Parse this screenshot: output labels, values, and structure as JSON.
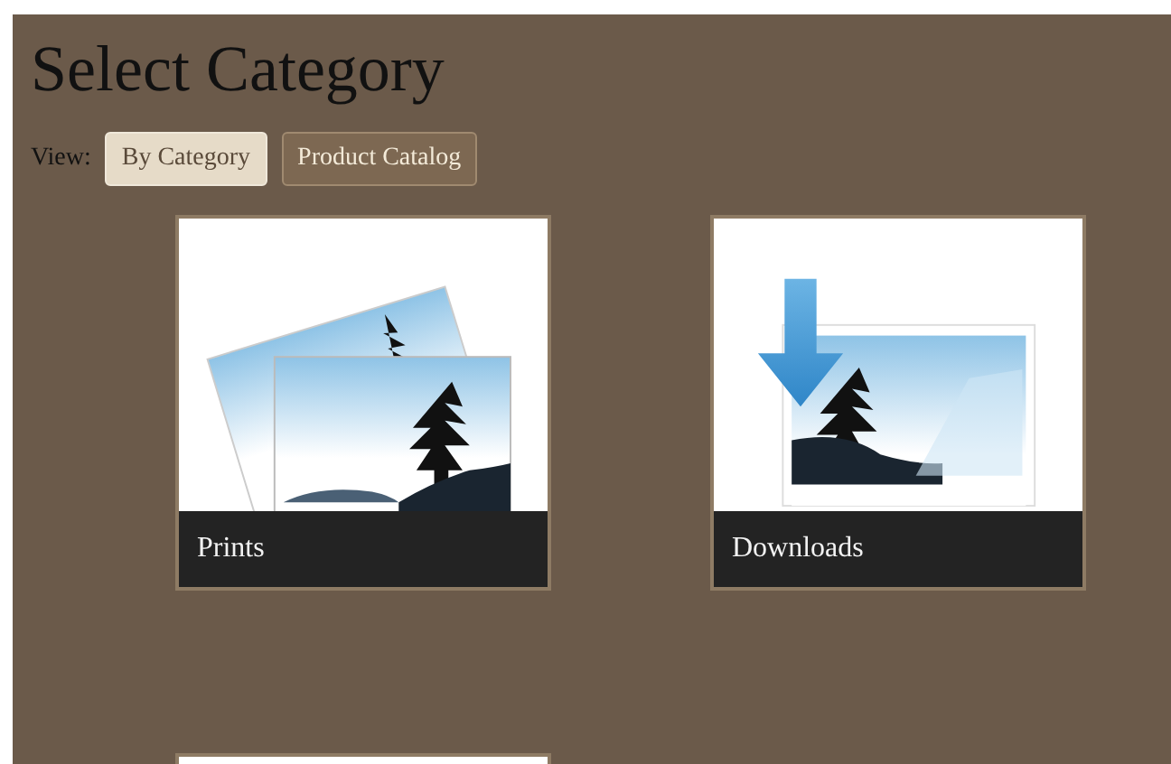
{
  "title": "Select Category",
  "view": {
    "label": "View:",
    "options": [
      {
        "label": "By Category",
        "selected": true
      },
      {
        "label": "Product Catalog",
        "selected": false
      }
    ]
  },
  "categories": [
    {
      "kind": "prints",
      "label": "Prints"
    },
    {
      "kind": "downloads",
      "label": "Downloads"
    },
    {
      "kind": "blank"
    }
  ]
}
